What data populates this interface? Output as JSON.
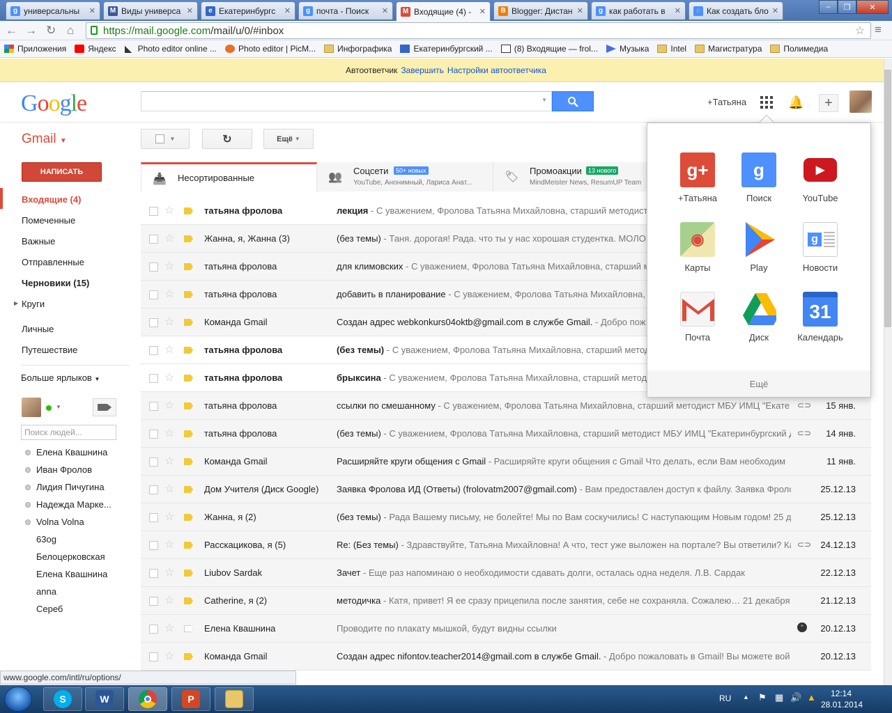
{
  "browser": {
    "tabs": [
      {
        "title": "универсальны",
        "color": "#4d90fe",
        "glyph": "g"
      },
      {
        "title": "Виды универса",
        "color": "#3b5998",
        "glyph": "M"
      },
      {
        "title": "Екатеринбургс",
        "color": "#3366cc",
        "glyph": "e"
      },
      {
        "title": "почта - Поиск",
        "color": "#4d90fe",
        "glyph": "g"
      },
      {
        "title": "Входящие (4) -",
        "color": "#dd4b39",
        "glyph": "M"
      },
      {
        "title": "Blogger: Дистан",
        "color": "#f57d00",
        "glyph": "B"
      },
      {
        "title": "как работать в",
        "color": "#4d90fe",
        "glyph": "g"
      },
      {
        "title": "Как создать бло",
        "color": "#4d90fe",
        "glyph": "◌"
      }
    ],
    "url_host": "https://mail.google.com",
    "url_path": "/mail/u/0/#inbox",
    "bookmarks": [
      {
        "label": "Приложения",
        "kind": "apps"
      },
      {
        "label": "Яндекс",
        "kind": "yandex"
      },
      {
        "label": "Photo editor online ...",
        "kind": "pen"
      },
      {
        "label": "Photo editor | PicM...",
        "kind": "pic"
      },
      {
        "label": "Инфографика",
        "kind": "folder"
      },
      {
        "label": "Екатеринбургский ...",
        "kind": "site"
      },
      {
        "label": "(8) Входящие — frol...",
        "kind": "mail"
      },
      {
        "label": "Музыка",
        "kind": "play"
      },
      {
        "label": "Intel",
        "kind": "folder"
      },
      {
        "label": "Магистратура",
        "kind": "folder"
      },
      {
        "label": "Полимедиа",
        "kind": "folder"
      }
    ]
  },
  "vacation": {
    "text": "Автоответчик",
    "end": "Завершить",
    "settings": "Настройки автоответчика"
  },
  "header": {
    "user": "+Татьяна"
  },
  "toolbar": {
    "gmail": "Gmail",
    "more": "Ещё"
  },
  "compose": "НАПИСАТЬ",
  "nav": {
    "inbox": "Входящие (4)",
    "starred": "Помеченные",
    "important": "Важные",
    "sent": "Отправленные",
    "drafts": "Черновики (15)",
    "circles": "Круги",
    "personal": "Личные",
    "travel": "Путешествие",
    "more_labels": "Больше ярлыков"
  },
  "chat": {
    "search_placeholder": "Поиск людей...",
    "contacts_online": [
      "Елена Квашнина",
      "Иван Фролов",
      "Лидия Пичугина",
      "Надежда Марке...",
      "Volna Volna"
    ],
    "contacts_offline": [
      "63og",
      "Белоцерковская",
      "Елена Квашнина",
      "anna",
      "Сереб"
    ]
  },
  "tabs": [
    {
      "label": "Несортированные",
      "sub": "",
      "badge": "",
      "badge_color": ""
    },
    {
      "label": "Соцсети",
      "sub": "YouTube, Анонимный, Лариса Анат...",
      "badge": "50+ новых",
      "badge_color": "#4d90fe"
    },
    {
      "label": "Промоакции",
      "sub": "MindMeister News, ResumUP Team",
      "badge": "13 нового",
      "badge_color": "#16a765"
    }
  ],
  "emails": [
    {
      "from": "татьяна фролова",
      "subject": "лекция",
      "snippet": " - С уважением, Фролова Татьяна Михайловна, старший методист",
      "date": "",
      "unread": true,
      "important": true,
      "attach": false
    },
    {
      "from": "Жанна, я, Жанна (3)",
      "subject": "(без темы)",
      "snippet": " - Таня. дорогая! Рада. что ты у нас хорошая студентка. МОЛО",
      "date": "",
      "unread": false,
      "important": true,
      "attach": false
    },
    {
      "from": "татьяна фролова",
      "subject": "для климовских",
      "snippet": " - С уважением, Фролова Татьяна Михайловна, старший м",
      "date": "",
      "unread": false,
      "important": true,
      "attach": false
    },
    {
      "from": "татьяна фролова",
      "subject": "добавить в планирование",
      "snippet": " - С уважением, Фролова Татьяна Михайловна,",
      "date": "",
      "unread": false,
      "important": true,
      "attach": false
    },
    {
      "from": "Команда Gmail",
      "subject": "Создан адрес webkonkurs04oktb@gmail.com в службе Gmail.",
      "snippet": " - Добро пож",
      "date": "",
      "unread": false,
      "important": true,
      "attach": false
    },
    {
      "from": "татьяна фролова",
      "subject": "(без темы)",
      "snippet": " - С уважением, Фролова Татьяна Михайловна, старший метод",
      "date": "",
      "unread": true,
      "important": true,
      "attach": false
    },
    {
      "from": "татьяна фролова",
      "subject": "брыксина",
      "snippet": " - С уважением, Фролова Татьяна Михайловна, старший метод",
      "date": "",
      "unread": true,
      "important": true,
      "attach": false
    },
    {
      "from": "татьяна фролова",
      "subject": "ссылки по смешанному",
      "snippet": " - С уважением, Фролова Татьяна Михайловна, старший методист МБУ ИМЦ \"Екате",
      "date": "15 янв.",
      "unread": false,
      "important": true,
      "attach": true
    },
    {
      "from": "татьяна фролова",
      "subject": "(без темы)",
      "snippet": " - С уважением, Фролова Татьяна Михайловна, старший методист МБУ ИМЦ \"Екатеринбургский Д",
      "date": "14 янв.",
      "unread": false,
      "important": true,
      "attach": true
    },
    {
      "from": "Команда Gmail",
      "subject": "Расширяйте круги общения с Gmail",
      "snippet": " - Расширяйте круги общения с Gmail Что делать, если Вам необходим",
      "date": "11 янв.",
      "unread": false,
      "important": true,
      "attach": false
    },
    {
      "from": "Дом Учителя (Диск Google)",
      "subject": "Заявка Фролова ИД (Ответы) (frolovatm2007@gmail.com)",
      "snippet": " - Вам предоставлен доступ к файлу. Заявка Фроло",
      "date": "25.12.13",
      "unread": false,
      "important": true,
      "attach": false
    },
    {
      "from": "Жанна, я (2)",
      "subject": "(без темы)",
      "snippet": " - Рада Вашему письму, не болейте! Мы по Вам соскучились! С наступающим Новым годом! 25 д",
      "date": "25.12.13",
      "unread": false,
      "important": true,
      "attach": false
    },
    {
      "from": "Расскацикова, я (5)",
      "subject": "Re: (Без темы)",
      "snippet": " - Здравствуйте, Татьяна Михайловна! А что, тест уже выложен на портале? Вы ответили? Ка",
      "date": "24.12.13",
      "unread": false,
      "important": true,
      "attach": true
    },
    {
      "from": "Liubov Sardak",
      "subject": "Зачет",
      "snippet": " - Еще раз напоминаю о необходимости сдавать долги, осталась одна неделя. Л.В. Сардак",
      "date": "22.12.13",
      "unread": false,
      "important": true,
      "attach": false
    },
    {
      "from": "Catherine, я (2)",
      "subject": "методичка",
      "snippet": " - Катя, привет! Я ее сразу прицепила после занятия, себе не сохраняла. Сожалею… 21 декабря 2",
      "date": "21.12.13",
      "unread": false,
      "important": true,
      "attach": false
    },
    {
      "from": "Елена Квашнина",
      "subject": "",
      "snippet": "Проводите по плакату мышкой, будут видны ссылки",
      "date": "20.12.13",
      "unread": false,
      "important": false,
      "attach": false
    },
    {
      "from": "Команда Gmail",
      "subject": "Создан адрес nifontov.teacher2014@gmail.com в службе Gmail.",
      "snippet": " - Добро пожаловать в Gmail! Вы можете вой",
      "date": "20.12.13",
      "unread": false,
      "important": true,
      "attach": false
    }
  ],
  "apps": {
    "items": [
      {
        "label": "+Татьяна",
        "glyph": "g+",
        "color": "#dd4b39"
      },
      {
        "label": "Поиск",
        "glyph": "g",
        "color": "#4d90fe"
      },
      {
        "label": "YouTube",
        "glyph": "▶",
        "color": "#cc181e"
      },
      {
        "label": "Карты",
        "glyph": "📍",
        "color": "#7ab55c"
      },
      {
        "label": "Play",
        "glyph": "▶",
        "color": "#34a853"
      },
      {
        "label": "Новости",
        "glyph": "g",
        "color": "#4d90fe"
      },
      {
        "label": "Почта",
        "glyph": "M",
        "color": "#dd4b39"
      },
      {
        "label": "Диск",
        "glyph": "▲",
        "color": "#1e9e54"
      },
      {
        "label": "Календарь",
        "glyph": "31",
        "color": "#4285f4"
      }
    ],
    "more": "Ещё"
  },
  "status_url": "www.google.com/intl/ru/options/",
  "taskbar": {
    "lang": "RU",
    "time": "12:14",
    "date": "28.01.2014"
  }
}
